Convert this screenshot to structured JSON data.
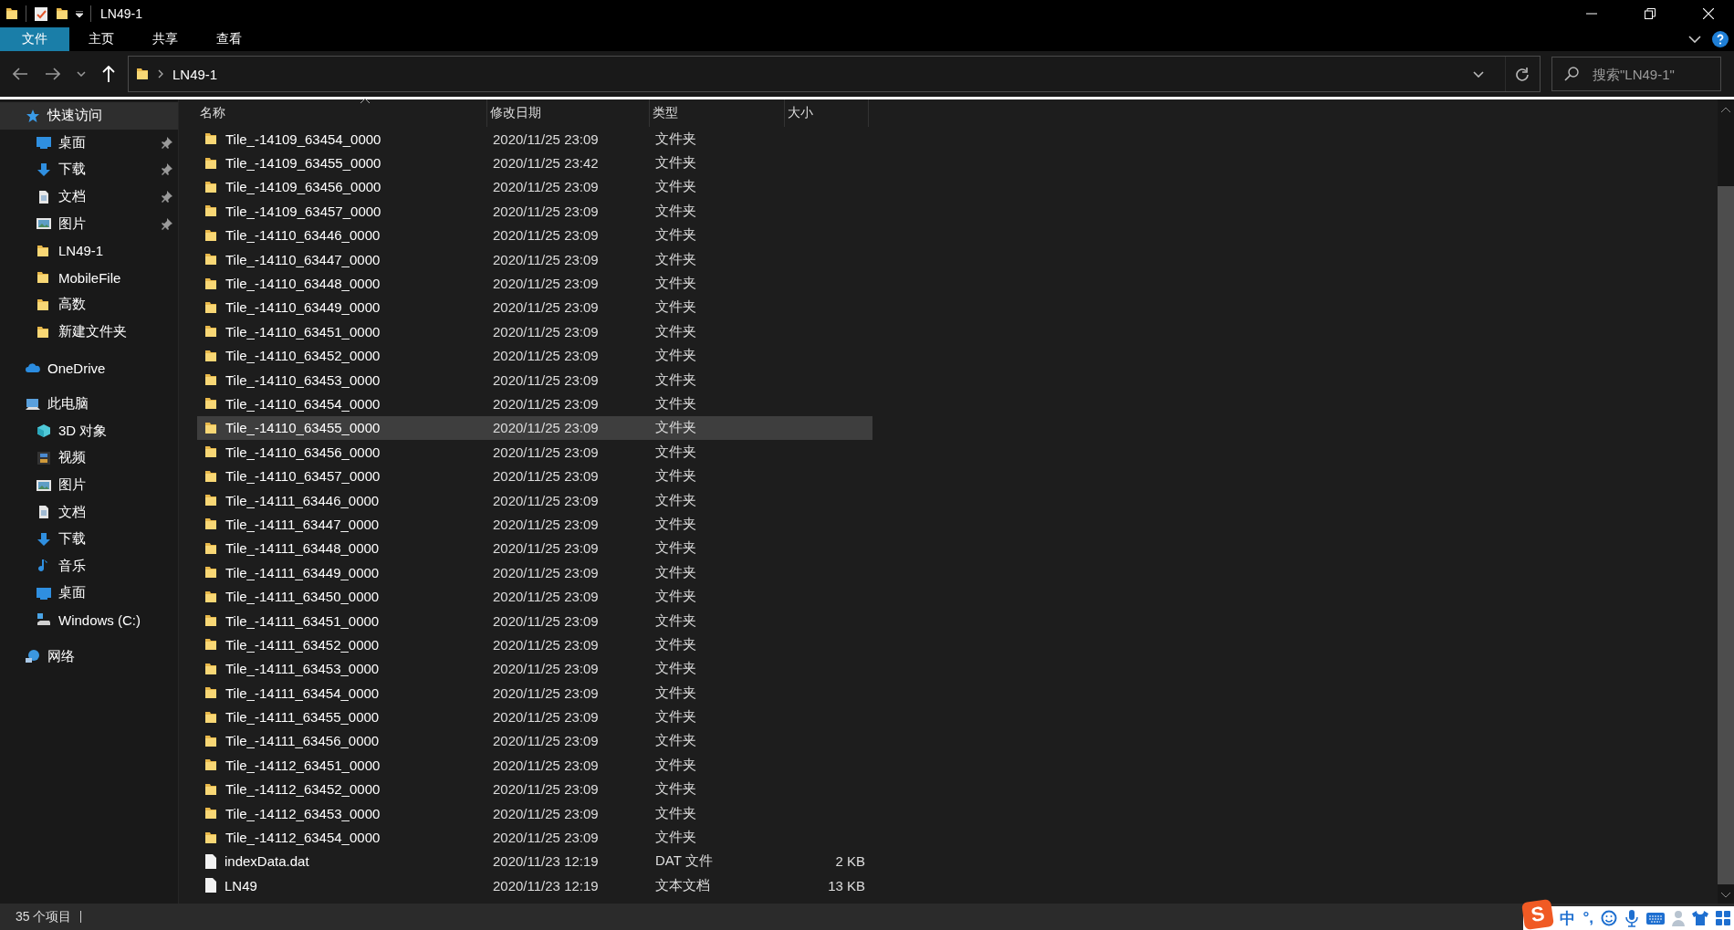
{
  "window": {
    "title": "LN49-1"
  },
  "ribbon": {
    "tabs": [
      {
        "label": "文件",
        "selected": true
      },
      {
        "label": "主页",
        "selected": false
      },
      {
        "label": "共享",
        "selected": false
      },
      {
        "label": "查看",
        "selected": false
      }
    ]
  },
  "address_bar": {
    "path": "LN49-1",
    "search": {
      "placeholder": "搜索\"LN49-1\""
    }
  },
  "sidebar": {
    "items": [
      {
        "label": "快速访问",
        "kind": "star",
        "selected": true,
        "children": [
          {
            "label": "桌面",
            "kind": "desktop",
            "pinned": true
          },
          {
            "label": "下载",
            "kind": "download",
            "pinned": true
          },
          {
            "label": "文档",
            "kind": "document",
            "pinned": true
          },
          {
            "label": "图片",
            "kind": "picture",
            "pinned": true
          },
          {
            "label": "LN49-1",
            "kind": "folder",
            "pinned": false
          },
          {
            "label": "MobileFile",
            "kind": "folder",
            "pinned": false
          },
          {
            "label": "高数",
            "kind": "folder",
            "pinned": false
          },
          {
            "label": "新建文件夹",
            "kind": "folder",
            "pinned": false
          }
        ]
      },
      {
        "label": "OneDrive",
        "kind": "cloud",
        "selected": false
      },
      {
        "label": "此电脑",
        "kind": "computer",
        "selected": false,
        "children": [
          {
            "label": "3D 对象",
            "kind": "cube"
          },
          {
            "label": "视频",
            "kind": "video"
          },
          {
            "label": "图片",
            "kind": "picture"
          },
          {
            "label": "文档",
            "kind": "document"
          },
          {
            "label": "下载",
            "kind": "download"
          },
          {
            "label": "音乐",
            "kind": "music"
          },
          {
            "label": "桌面",
            "kind": "desktop"
          },
          {
            "label": "Windows (C:)",
            "kind": "drive"
          }
        ]
      },
      {
        "label": "网络",
        "kind": "network",
        "selected": false
      }
    ]
  },
  "file_list": {
    "columns": [
      "名称",
      "修改日期",
      "类型",
      "大小"
    ],
    "rows": [
      {
        "kind": "folder",
        "name": "Tile_-14109_63454_0000",
        "date": "2020/11/25 23:09",
        "type": "文件夹",
        "selected": false
      },
      {
        "kind": "folder",
        "name": "Tile_-14109_63455_0000",
        "date": "2020/11/25 23:42",
        "type": "文件夹",
        "selected": false
      },
      {
        "kind": "folder",
        "name": "Tile_-14109_63456_0000",
        "date": "2020/11/25 23:09",
        "type": "文件夹",
        "selected": false
      },
      {
        "kind": "folder",
        "name": "Tile_-14109_63457_0000",
        "date": "2020/11/25 23:09",
        "type": "文件夹",
        "selected": false
      },
      {
        "kind": "folder",
        "name": "Tile_-14110_63446_0000",
        "date": "2020/11/25 23:09",
        "type": "文件夹",
        "selected": false
      },
      {
        "kind": "folder",
        "name": "Tile_-14110_63447_0000",
        "date": "2020/11/25 23:09",
        "type": "文件夹",
        "selected": false
      },
      {
        "kind": "folder",
        "name": "Tile_-14110_63448_0000",
        "date": "2020/11/25 23:09",
        "type": "文件夹",
        "selected": false
      },
      {
        "kind": "folder",
        "name": "Tile_-14110_63449_0000",
        "date": "2020/11/25 23:09",
        "type": "文件夹",
        "selected": false
      },
      {
        "kind": "folder",
        "name": "Tile_-14110_63451_0000",
        "date": "2020/11/25 23:09",
        "type": "文件夹",
        "selected": false
      },
      {
        "kind": "folder",
        "name": "Tile_-14110_63452_0000",
        "date": "2020/11/25 23:09",
        "type": "文件夹",
        "selected": false
      },
      {
        "kind": "folder",
        "name": "Tile_-14110_63453_0000",
        "date": "2020/11/25 23:09",
        "type": "文件夹",
        "selected": false
      },
      {
        "kind": "folder",
        "name": "Tile_-14110_63454_0000",
        "date": "2020/11/25 23:09",
        "type": "文件夹",
        "selected": false
      },
      {
        "kind": "folder",
        "name": "Tile_-14110_63455_0000",
        "date": "2020/11/25 23:09",
        "type": "文件夹",
        "selected": true
      },
      {
        "kind": "folder",
        "name": "Tile_-14110_63456_0000",
        "date": "2020/11/25 23:09",
        "type": "文件夹",
        "selected": false
      },
      {
        "kind": "folder",
        "name": "Tile_-14110_63457_0000",
        "date": "2020/11/25 23:09",
        "type": "文件夹",
        "selected": false
      },
      {
        "kind": "folder",
        "name": "Tile_-14111_63446_0000",
        "date": "2020/11/25 23:09",
        "type": "文件夹",
        "selected": false
      },
      {
        "kind": "folder",
        "name": "Tile_-14111_63447_0000",
        "date": "2020/11/25 23:09",
        "type": "文件夹",
        "selected": false
      },
      {
        "kind": "folder",
        "name": "Tile_-14111_63448_0000",
        "date": "2020/11/25 23:09",
        "type": "文件夹",
        "selected": false
      },
      {
        "kind": "folder",
        "name": "Tile_-14111_63449_0000",
        "date": "2020/11/25 23:09",
        "type": "文件夹",
        "selected": false
      },
      {
        "kind": "folder",
        "name": "Tile_-14111_63450_0000",
        "date": "2020/11/25 23:09",
        "type": "文件夹",
        "selected": false
      },
      {
        "kind": "folder",
        "name": "Tile_-14111_63451_0000",
        "date": "2020/11/25 23:09",
        "type": "文件夹",
        "selected": false
      },
      {
        "kind": "folder",
        "name": "Tile_-14111_63452_0000",
        "date": "2020/11/25 23:09",
        "type": "文件夹",
        "selected": false
      },
      {
        "kind": "folder",
        "name": "Tile_-14111_63453_0000",
        "date": "2020/11/25 23:09",
        "type": "文件夹",
        "selected": false
      },
      {
        "kind": "folder",
        "name": "Tile_-14111_63454_0000",
        "date": "2020/11/25 23:09",
        "type": "文件夹",
        "selected": false
      },
      {
        "kind": "folder",
        "name": "Tile_-14111_63455_0000",
        "date": "2020/11/25 23:09",
        "type": "文件夹",
        "selected": false
      },
      {
        "kind": "folder",
        "name": "Tile_-14111_63456_0000",
        "date": "2020/11/25 23:09",
        "type": "文件夹",
        "selected": false
      },
      {
        "kind": "folder",
        "name": "Tile_-14112_63451_0000",
        "date": "2020/11/25 23:09",
        "type": "文件夹",
        "selected": false
      },
      {
        "kind": "folder",
        "name": "Tile_-14112_63452_0000",
        "date": "2020/11/25 23:09",
        "type": "文件夹",
        "selected": false
      },
      {
        "kind": "folder",
        "name": "Tile_-14112_63453_0000",
        "date": "2020/11/25 23:09",
        "type": "文件夹",
        "selected": false
      },
      {
        "kind": "folder",
        "name": "Tile_-14112_63454_0000",
        "date": "2020/11/25 23:09",
        "type": "文件夹",
        "selected": false
      },
      {
        "kind": "file",
        "name": "indexData.dat",
        "date": "2020/11/23 12:19",
        "type": "DAT 文件",
        "size": "2 KB",
        "selected": false
      },
      {
        "kind": "file",
        "name": "LN49",
        "date": "2020/11/23 12:19",
        "type": "文本文档",
        "size": "13 KB",
        "selected": false
      }
    ]
  },
  "status_bar": {
    "item_count": "35 个项目"
  },
  "ime_toolbar": {
    "logo": "S",
    "mode": "中",
    "punctuation": "°,"
  }
}
